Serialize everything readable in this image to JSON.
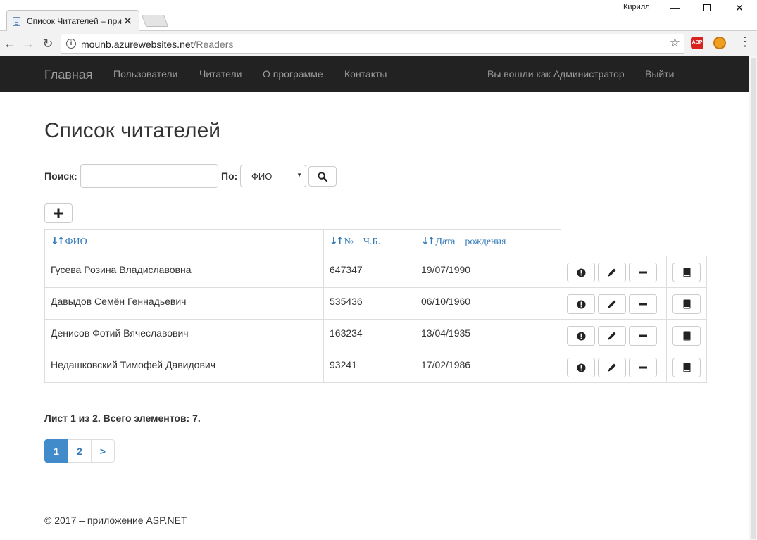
{
  "browser": {
    "tab_title": "Список Читателей – при",
    "tab_close": "✕",
    "window_user": "Кирилл",
    "win_minimize": "—",
    "win_close": "✕",
    "url_host": "mounb.azurewebsites.net",
    "url_path": "/Readers",
    "info_glyph": "i",
    "star_glyph": "☆",
    "back_glyph": "←",
    "forward_glyph": "→",
    "reload_glyph": "↻",
    "menu_glyph": "⋮",
    "abp_label": "ABP"
  },
  "navbar": {
    "brand": "Главная",
    "items": [
      {
        "label": "Пользователи"
      },
      {
        "label": "Читатели"
      },
      {
        "label": "О программе"
      },
      {
        "label": "Контакты"
      }
    ],
    "logged_in": "Вы вошли как Администратор",
    "logout": "Выйти"
  },
  "page": {
    "title": "Список читателей",
    "search_label": "Поиск:",
    "search_value": "",
    "by_label": "По:",
    "by_selected": "ФИО"
  },
  "table": {
    "headers": {
      "fio": "ФИО",
      "number": "№    Ч.Б.",
      "birth": "Дата    рождения"
    },
    "rows": [
      {
        "fio": "Гусева Розина Владиславовна",
        "number": "647347",
        "birth": "19/07/1990"
      },
      {
        "fio": "Давыдов Семён Геннадьевич",
        "number": "535436",
        "birth": "06/10/1960"
      },
      {
        "fio": "Денисов Фотий Вячеславович",
        "number": "163234",
        "birth": "13/04/1935"
      },
      {
        "fio": "Недашковский Тимофей Давидович",
        "number": "93241",
        "birth": "17/02/1986"
      }
    ]
  },
  "pager": {
    "info": "Лист 1 из 2. Всего элементов: 7.",
    "pages": [
      "1",
      "2",
      ">"
    ]
  },
  "footer": {
    "text": "© 2017 – приложение ASP.NET"
  },
  "icons": {
    "sort": "sort-icon",
    "info": "exclamation-circle-icon",
    "edit": "pencil-icon",
    "delete": "minus-icon",
    "book": "book-icon",
    "search": "search-icon",
    "add": "plus-icon"
  },
  "colors": {
    "navbar_bg": "#222222",
    "link": "#337ab7",
    "active_page": "#428bca"
  }
}
